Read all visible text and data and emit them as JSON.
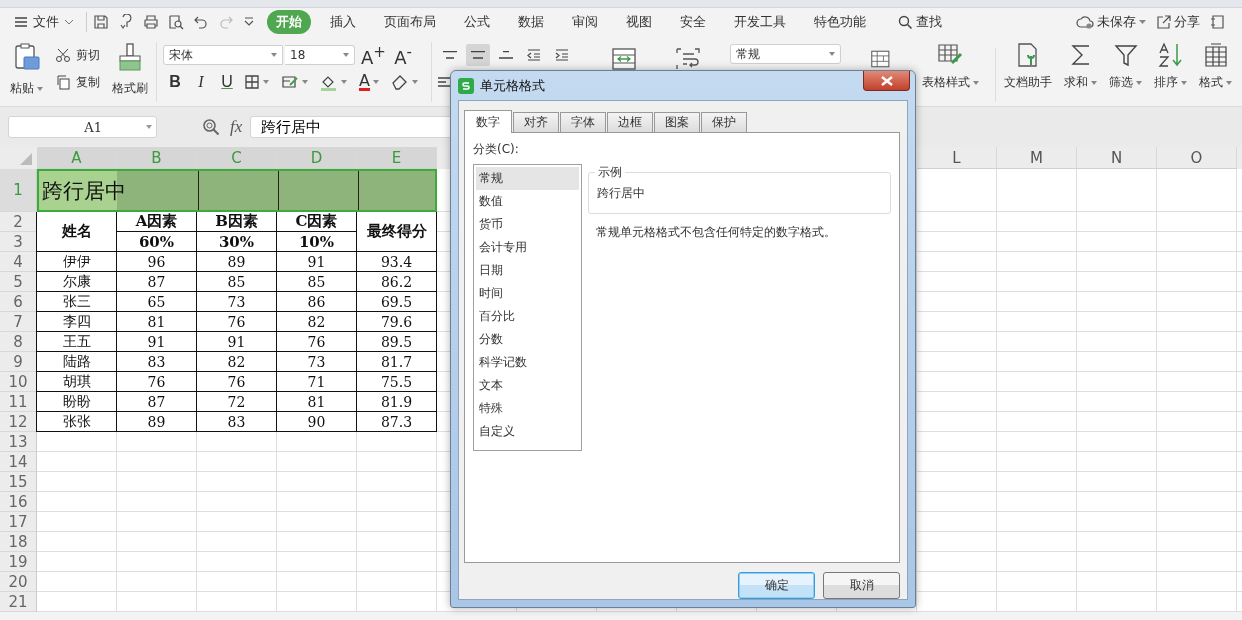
{
  "menu": {
    "file": "文件",
    "tabs": [
      {
        "label": "开始",
        "selected": true
      },
      {
        "label": "插入",
        "selected": false
      },
      {
        "label": "页面布局",
        "selected": false
      },
      {
        "label": "公式",
        "selected": false
      },
      {
        "label": "数据",
        "selected": false
      },
      {
        "label": "审阅",
        "selected": false
      },
      {
        "label": "视图",
        "selected": false
      },
      {
        "label": "安全",
        "selected": false
      },
      {
        "label": "开发工具",
        "selected": false
      },
      {
        "label": "特色功能",
        "selected": false
      }
    ],
    "search": "查找",
    "save_status": "未保存",
    "share": "分享"
  },
  "ribbon": {
    "paste": "粘贴",
    "cut": "剪切",
    "copy": "复制",
    "format_painter": "格式刷",
    "font_name": "宋体",
    "font_size": "18",
    "grow": "A$^{+}$",
    "shrink": "A$^{-}$",
    "styles": [
      "B",
      "I",
      "U"
    ],
    "font_color": "A",
    "vertical_align": [
      {
        "selected": false
      },
      {
        "selected": true
      },
      {
        "selected": false
      }
    ],
    "number_format": "常规",
    "tools": [
      {
        "label": "表格样式",
        "dropdown": true
      },
      {
        "label": "文档助手",
        "dropdown": false
      },
      {
        "label": "求和",
        "dropdown": true
      },
      {
        "label": "筛选",
        "dropdown": true
      },
      {
        "label": "排序",
        "dropdown": true
      },
      {
        "label": "格式",
        "dropdown": true
      }
    ]
  },
  "formula_bar": {
    "name_box": "A1",
    "fx": "fx",
    "formula": "跨行居中"
  },
  "sheet": {
    "columns_left": [
      {
        "label": "A",
        "selected": true
      },
      {
        "label": "B",
        "selected": true
      },
      {
        "label": "C",
        "selected": true
      },
      {
        "label": "D",
        "selected": true
      },
      {
        "label": "E",
        "selected": true
      }
    ],
    "columns_right": [
      {
        "label": "L",
        "selected": false
      },
      {
        "label": "M",
        "selected": false
      },
      {
        "label": "N",
        "selected": false
      },
      {
        "label": "O",
        "selected": false
      }
    ],
    "row_headers": [
      {
        "label": "1",
        "selected": true
      },
      {
        "label": "2",
        "selected": false
      },
      {
        "label": "3",
        "selected": false
      },
      {
        "label": "4",
        "selected": false
      },
      {
        "label": "5",
        "selected": false
      },
      {
        "label": "6",
        "selected": false
      },
      {
        "label": "7",
        "selected": false
      },
      {
        "label": "8",
        "selected": false
      },
      {
        "label": "9",
        "selected": false
      },
      {
        "label": "10",
        "selected": false
      },
      {
        "label": "11",
        "selected": false
      },
      {
        "label": "12",
        "selected": false
      },
      {
        "label": "13",
        "selected": false
      },
      {
        "label": "14",
        "selected": false
      },
      {
        "label": "15",
        "selected": false
      },
      {
        "label": "16",
        "selected": false
      },
      {
        "label": "17",
        "selected": false
      },
      {
        "label": "18",
        "selected": false
      },
      {
        "label": "19",
        "selected": false
      },
      {
        "label": "20",
        "selected": false
      },
      {
        "label": "21",
        "selected": false
      }
    ],
    "title": "跨行居中",
    "name_header": "姓名",
    "factors": [
      {
        "label": "A因素",
        "weight": "60%"
      },
      {
        "label": "B因素",
        "weight": "30%"
      },
      {
        "label": "C因素",
        "weight": "10%"
      }
    ],
    "total_header": "最终得分",
    "rows": [
      {
        "name": "伊伊",
        "scores": [
          "96",
          "89",
          "91"
        ],
        "total": "93.4"
      },
      {
        "name": "尔康",
        "scores": [
          "87",
          "85",
          "85"
        ],
        "total": "86.2"
      },
      {
        "name": "张三",
        "scores": [
          "65",
          "73",
          "86"
        ],
        "total": "69.5"
      },
      {
        "name": "李四",
        "scores": [
          "81",
          "76",
          "82"
        ],
        "total": "79.6"
      },
      {
        "name": "王五",
        "scores": [
          "91",
          "91",
          "76"
        ],
        "total": "89.5"
      },
      {
        "name": "陆路",
        "scores": [
          "83",
          "82",
          "73"
        ],
        "total": "81.7"
      },
      {
        "name": "胡琪",
        "scores": [
          "76",
          "76",
          "71"
        ],
        "total": "75.5"
      },
      {
        "name": "盼盼",
        "scores": [
          "87",
          "72",
          "81"
        ],
        "total": "81.9"
      },
      {
        "name": "张张",
        "scores": [
          "89",
          "83",
          "90"
        ],
        "total": "87.3"
      }
    ]
  },
  "dialog": {
    "title": "单元格格式",
    "tabs": [
      {
        "label": "数字",
        "selected": true
      },
      {
        "label": "对齐",
        "selected": false
      },
      {
        "label": "字体",
        "selected": false
      },
      {
        "label": "边框",
        "selected": false
      },
      {
        "label": "图案",
        "selected": false
      },
      {
        "label": "保护",
        "selected": false
      }
    ],
    "category_label": "分类(C):",
    "categories": [
      {
        "label": "常规",
        "selected": true
      },
      {
        "label": "数值",
        "selected": false
      },
      {
        "label": "货币",
        "selected": false
      },
      {
        "label": "会计专用",
        "selected": false
      },
      {
        "label": "日期",
        "selected": false
      },
      {
        "label": "时间",
        "selected": false
      },
      {
        "label": "百分比",
        "selected": false
      },
      {
        "label": "分数",
        "selected": false
      },
      {
        "label": "科学记数",
        "selected": false
      },
      {
        "label": "文本",
        "selected": false
      },
      {
        "label": "特殊",
        "selected": false
      },
      {
        "label": "自定义",
        "selected": false
      }
    ],
    "sample_legend": "示例",
    "sample": "跨行居中",
    "description": "常规单元格格式不包含任何特定的数字格式。",
    "buttons": [
      {
        "label": "确定",
        "default": true
      },
      {
        "label": "取消",
        "default": false
      }
    ]
  }
}
